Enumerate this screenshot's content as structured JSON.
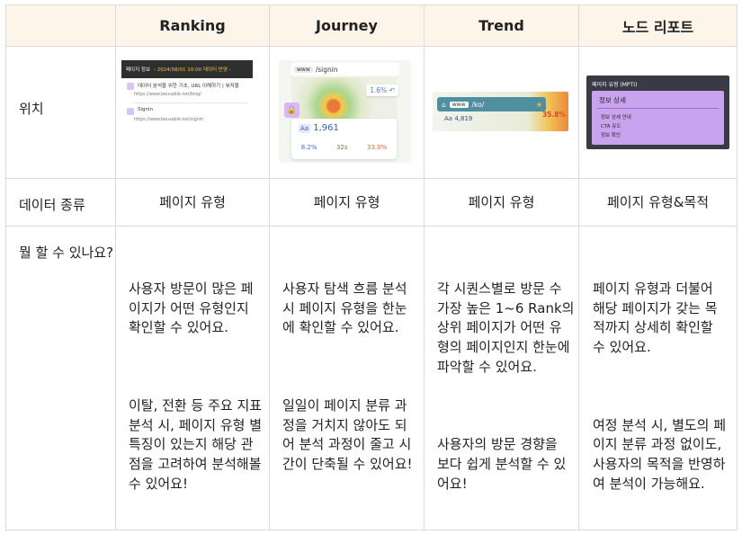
{
  "header": {
    "col1": "Ranking",
    "col2": "Journey",
    "col3": "Trend",
    "col4": "노드 리포트"
  },
  "rows": {
    "location": "위치",
    "data_type": "데이터 종류",
    "what_can_do": "뭘 할 수 있나요?"
  },
  "data_types": [
    "페이지 유형",
    "페이지 유형",
    "페이지 유형",
    "페이지 유형&목적"
  ],
  "descriptions": [
    [
      "사용자 방문이 많은 페\n이지가 어떤 유형인지\n확인할 수 있어요.",
      "이탈, 전환 등 주요 지표\n분석 시, 페이지 유형 별\n특징이 있는지 해당 관\n점을 고려하여 분석해볼\n수 있어요!"
    ],
    [
      "사용자 탐색 흐름 분석\n시 페이지 유형을 한눈\n에 확인할 수 있어요.",
      "일일이 페이지 분류 과\n정을 거치지 않아도 되\n어 분석 과정이 줄고 시\n간이 단축될 수 있어요!"
    ],
    [
      "각 시퀀스별로 방문 수\n가장 높은 1~6 Rank의\n상위 페이지가 어떤 유\n형의 페이지인지 한눈에\n파악할 수 있어요.",
      "사용자의 방문 경향을\n보다 쉽게 분석할 수 있\n어요!"
    ],
    [
      "페이지 유형과 더불어\n해당 페이지가 갖는 목\n적까지 상세히 확인할\n수 있어요.",
      "여정 분석 시, 별도의 페\n이지 분류 과정 없이도,\n사용자의 목적을 반영하\n여 분석이 가능해요."
    ]
  ],
  "thumb_ranking": {
    "bar_label": "페이지 정보",
    "bar_note": "- 2024/08/01 10:00 데이터 반영 -",
    "item1_title": "데이터 분석을 위한 기초, URL 이해하기 | 뷰저블",
    "item1_url": "https://www.beusable.net/blog/",
    "item2_title": "Signin",
    "item2_url": "https://www.beusable.net/signin"
  },
  "thumb_journey": {
    "www": "www",
    "path": "/signin",
    "pct": "1.6%",
    "count": "1,961",
    "stat1": "8.2%",
    "stat2": "32s",
    "stat3": "33.0%"
  },
  "thumb_trend": {
    "www": "www",
    "path": "/ko/",
    "pct": "35.8%",
    "count": "4,819"
  },
  "thumb_node": {
    "header": "페이지 유형 (MPTI)",
    "panel_title": "정보 상세",
    "item1": "정보 상세 안내",
    "item2": "CTA 유도",
    "item3": "정보 확인"
  },
  "colors": {
    "header_bg": "#fdf4ea",
    "border": "#dadada",
    "purple": "#c9a3ee"
  }
}
